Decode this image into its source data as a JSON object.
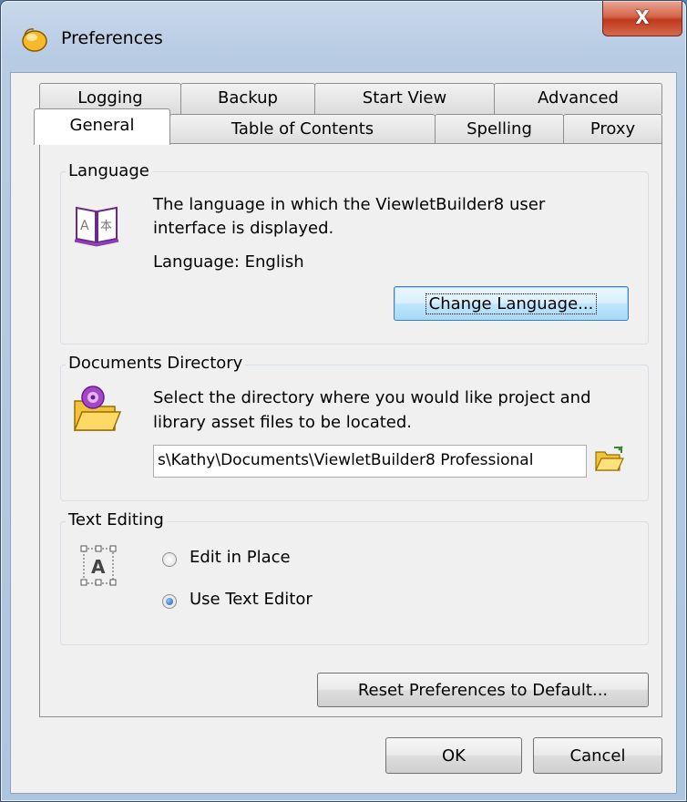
{
  "window": {
    "title": "Preferences",
    "close_glyph": "X"
  },
  "tabs_back": [
    "Logging",
    "Backup",
    "Start View",
    "Advanced"
  ],
  "tabs_front": [
    "General",
    "Table of Contents",
    "Spelling",
    "Proxy"
  ],
  "active_tab": "General",
  "language": {
    "group_label": "Language",
    "description_line1": "The language in which the ViewletBuilder8 user",
    "description_line2": "interface is displayed.",
    "current": "Language:  English",
    "change_button": "Change Language..."
  },
  "documents": {
    "group_label": "Documents Directory",
    "description_line1": "Select the directory where you would like project and",
    "description_line2": "library asset files to be located.",
    "path_value": "s\\Kathy\\Documents\\ViewletBuilder8 Professional"
  },
  "text_editing": {
    "group_label": "Text Editing",
    "options": [
      {
        "label": "Edit in Place",
        "checked": false
      },
      {
        "label": "Use Text Editor",
        "checked": true
      }
    ]
  },
  "buttons": {
    "reset": "Reset Preferences to Default...",
    "ok": "OK",
    "cancel": "Cancel"
  },
  "icons": {
    "app": "app-logo-icon",
    "language": "book-language-icon",
    "documents": "folder-icon",
    "browse": "open-folder-icon",
    "text": "text-frame-icon"
  },
  "colors": {
    "close_button": "#c0391c",
    "focus_button": "#3c7fb1",
    "radio_checked": "#1c5fa8"
  }
}
